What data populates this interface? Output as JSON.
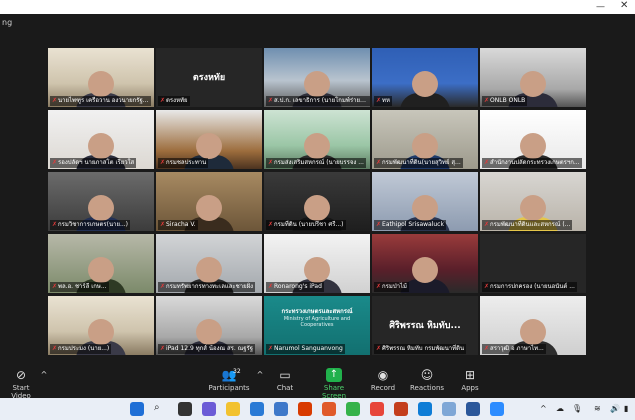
{
  "window": {
    "title_fragment": "ng",
    "minimize": "—",
    "close": "✕"
  },
  "tiles": [
    {
      "name": "นายไพฑูร เครือวาน องวนายกรัฐ...",
      "muted": true,
      "scene": "office-tan"
    },
    {
      "name": "ตรงหทัย",
      "big": "ตรงหทัย",
      "muted": true,
      "scene": "dark"
    },
    {
      "name": "ส.ป.ก. เลขาธิการ (นายโกมพ์ร่ายน์ ท...",
      "muted": true,
      "scene": "meeting-blue"
    },
    {
      "name": "ทห",
      "muted": true,
      "scene": "blue-board"
    },
    {
      "name": "ONLB ONLB",
      "muted": true,
      "scene": "office-gray"
    },
    {
      "name": "รองปลัดฯ นายภาสโต เรียวใส",
      "muted": true,
      "scene": "office-white"
    },
    {
      "name": "กรมชลประทาน",
      "muted": true,
      "scene": "office-wood"
    },
    {
      "name": "กรมส่งเสริมสหกรณ์ (นายบรรจง ...",
      "muted": true,
      "scene": "poster"
    },
    {
      "name": "กรมพัฒนาที่ดิน(นายสุวิทย์ สุ...",
      "muted": true,
      "scene": "mask-blue"
    },
    {
      "name": "สำนักงานปลัดกระทรวงเกษตรฯก...",
      "muted": true,
      "scene": "mask-white"
    },
    {
      "name": "กรมวิชาการเกษตร(นาย...)",
      "muted": true,
      "scene": "office-dark"
    },
    {
      "name": "Siracha V.",
      "muted": true,
      "scene": "shelf"
    },
    {
      "name": "กรมที่ดิน (นายปรีชา ศรี...)",
      "muted": true,
      "scene": "desk-dark"
    },
    {
      "name": "Eathipol Srisawaluck",
      "muted": true,
      "scene": "office-blue"
    },
    {
      "name": "กรมพัฒนาที่ดินและสหกรณ์ (...",
      "muted": true,
      "scene": "document"
    },
    {
      "name": "พล.อ. ชาร์ลี เกษ...",
      "muted": true,
      "scene": "active-room",
      "active": true
    },
    {
      "name": "กรมทรัพยากรทางทะเลและชายฝั่ง",
      "muted": true,
      "scene": "mask-gray"
    },
    {
      "name": "Ronarong's iPad",
      "muted": true,
      "scene": "office-light"
    },
    {
      "name": "กรมป่าไม้",
      "muted": true,
      "scene": "red-banner"
    },
    {
      "name": "กรมการปกครอง (นายนอนันต์ ...",
      "muted": true,
      "scene": "dark"
    },
    {
      "name": "กรมประมง (นาย...)",
      "muted": true,
      "scene": "office-tan"
    },
    {
      "name": "iPad 12.9 ทุกส์ น้องณ สร. ณฐรัฐ",
      "muted": true,
      "scene": "office-gray"
    },
    {
      "name": "Narumol Sanguanvong",
      "muted": true,
      "scene": "moac-logo",
      "logo_text": "กระทรวงเกษตรและสหกรณ์",
      "logo_sub": "Ministry of Agriculture and Cooperatives"
    },
    {
      "name": "ศิริพรรณ หิมทับ กรมพัฒนาที่ดิน",
      "big": "ศิริพรรณ หิมทับ...",
      "muted": true,
      "scene": "dark"
    },
    {
      "name": "สราวุฒิ อ ภาษาไท...",
      "muted": true,
      "scene": "white-room"
    }
  ],
  "toolbar": {
    "start_video": "Start Video",
    "participants": "Participants",
    "participants_count": "32",
    "chat": "Chat",
    "share_screen": "Share Screen",
    "record": "Record",
    "reactions": "Reactions",
    "apps": "Apps"
  },
  "colors": {
    "share": "#21b14c",
    "active_border": "#c8d94a",
    "muted": "#e23b3b"
  }
}
